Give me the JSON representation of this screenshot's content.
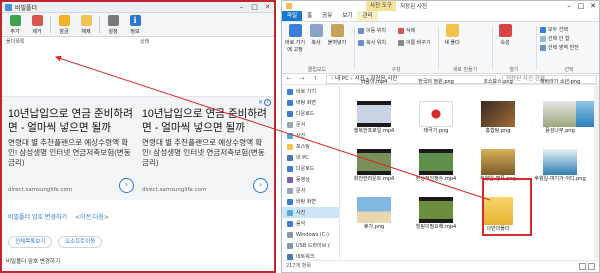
{
  "left_window": {
    "title": "비밀폴더",
    "toolbar": [
      {
        "label": "추가",
        "icon": "add-folder-icon"
      },
      {
        "label": "제거",
        "icon": "remove-folder-icon"
      },
      {
        "label": "잠금",
        "icon": "lock-icon"
      },
      {
        "label": "해제",
        "icon": "unlock-icon"
      },
      {
        "label": "설정",
        "icon": "tools-icon"
      },
      {
        "label": "정보",
        "icon": "info-icon"
      }
    ],
    "group_labels": {
      "list": "폴더목록",
      "state": "상태"
    },
    "ads": [
      {
        "headline": "10년납입으로 연금 준비하려면 - 얼마씩 넣으면 될까",
        "body": "연령대 별 추천플랜으로 예상수령액 확인! 삼성생명 인터넷 연금저축보험(변동금리)",
        "url": "direct.samsunglife.com"
      },
      {
        "headline": "10년납입으로 연금 준비하려면 - 얼마씩 넣으면 될까",
        "body": "연령대 별 추천플랜으로 예상수령액 확인! 삼성생명 인터넷 연금저축보험(변동금리)",
        "url": "direct.samsunglife.com"
      }
    ],
    "link_text": "비밀폴더 암호 변경하기",
    "more_link": "<이전 다음>",
    "pills": [
      "전체목록보기",
      "오소프트이동"
    ],
    "status": "비밀폴더 암호 변경하기"
  },
  "explorer": {
    "context_tab": "사진 도구",
    "window_title": "저장된 사진",
    "tabs": [
      "파일",
      "홈",
      "공유",
      "보기",
      "관리"
    ],
    "ribbon": {
      "clipboard_group": "클립보드",
      "organize_group": "구성",
      "new_group": "새로 만들기",
      "open_group": "열기",
      "select_group": "선택",
      "pin_label": "바로 가기에 고정",
      "copy_label": "복사",
      "paste_label": "붙여넣기",
      "move_label": "이동 위치",
      "copy_to_label": "복사 위치",
      "delete_label": "삭제",
      "rename_label": "이름 바꾸기",
      "new_folder_label": "새 폴더",
      "properties_label": "속성",
      "select_all": "모두 선택",
      "select_none": "선택 안 함",
      "invert_selection": "선택 영역 반전"
    },
    "path": "› 내 PC › 사진 › 저장된 사진",
    "search_placeholder": "저장된 사진 검색",
    "nav_items": [
      {
        "label": "바로 가기",
        "icon": "star-icon"
      },
      {
        "label": "바탕 화면",
        "icon": "desktop-icon"
      },
      {
        "label": "다운로드",
        "icon": "download-icon"
      },
      {
        "label": "문서",
        "icon": "document-icon"
      },
      {
        "label": "사진",
        "icon": "picture-icon"
      },
      {
        "label": "포스팅",
        "icon": "folder-icon"
      },
      {
        "label": "내 PC",
        "icon": "pc-icon"
      },
      {
        "label": "다운로드",
        "icon": "download-icon"
      },
      {
        "label": "동영상",
        "icon": "video-icon"
      },
      {
        "label": "문서",
        "icon": "document-icon"
      },
      {
        "label": "바탕 화면",
        "icon": "desktop-icon"
      },
      {
        "label": "사진",
        "icon": "picture-icon"
      },
      {
        "label": "음악",
        "icon": "music-icon"
      },
      {
        "label": "Windows (C:)",
        "icon": "drive-icon"
      },
      {
        "label": "USB 드라이브 (",
        "icon": "usb-icon"
      },
      {
        "label": "네트워크",
        "icon": "network-icon"
      },
      {
        "label": "USB 드라이브 (E",
        "icon": "usb-icon"
      }
    ],
    "files": [
      {
        "name": "바람이.mp4"
      },
      {
        "name": "한국의 정원.png"
      },
      {
        "name": "코스모스.png"
      },
      {
        "name": "해바라기 소년.png"
      },
      {
        "name": "행복한프로일.mp4"
      },
      {
        "name": "태극기.png"
      },
      {
        "name": "홍합탕.png"
      },
      {
        "name": "풍성나무.png"
      },
      {
        "name": "하늘바다사랑.mp4"
      },
      {
        "name": "화석.png"
      },
      {
        "name": "함경북도.png"
      },
      {
        "name": "한강.png"
      },
      {
        "name": "화천한라운트.mp4"
      },
      {
        "name": "환상적인정수.mp4"
      },
      {
        "name": "후월일-병폭.png"
      },
      {
        "name": "후월일-여기가 어디.png"
      },
      {
        "name": "휴가.png"
      },
      {
        "name": "힐링이필요해.mp4"
      },
      {
        "name": "나만의폴더"
      }
    ],
    "status": "217개 항목"
  }
}
